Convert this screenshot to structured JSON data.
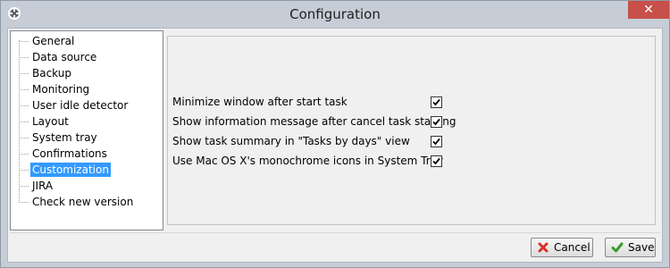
{
  "window": {
    "title": "Configuration"
  },
  "sidebar": {
    "items": [
      {
        "label": "General"
      },
      {
        "label": "Data source"
      },
      {
        "label": "Backup"
      },
      {
        "label": "Monitoring"
      },
      {
        "label": "User idle detector"
      },
      {
        "label": "Layout"
      },
      {
        "label": "System tray"
      },
      {
        "label": "Confirmations"
      },
      {
        "label": "Customization",
        "selected": true
      },
      {
        "label": "JIRA"
      },
      {
        "label": "Check new version"
      }
    ]
  },
  "panel": {
    "options": [
      {
        "label": "Minimize window after start task",
        "checked": true
      },
      {
        "label": "Show information message after cancel task starting",
        "checked": true
      },
      {
        "label": "Show task summary in \"Tasks by days\" view",
        "checked": true
      },
      {
        "label": "Use Mac OS X's monochrome icons in System Tray",
        "checked": true
      }
    ]
  },
  "buttons": {
    "cancel_label": "Cancel",
    "save_label": "Save"
  },
  "icons": {
    "close": "close-icon",
    "cancel": "red-x-icon",
    "save": "green-check-icon"
  },
  "colors": {
    "selection": "#3399ff",
    "close_button": "#c7504a",
    "frame": "#c6cdd6",
    "cancel_icon": "#d9322b",
    "save_icon": "#3a9a2e"
  }
}
